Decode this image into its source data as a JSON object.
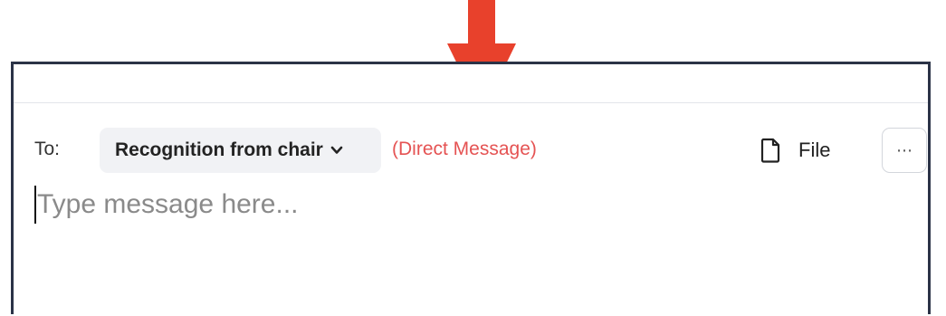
{
  "composer": {
    "to_label": "To:",
    "recipient": "Recognition from chair",
    "message_type": "(Direct Message)",
    "file_label": "File",
    "more_label": "⋯",
    "message_value": "",
    "message_placeholder": "Type message here..."
  },
  "icons": {
    "recipient_dropdown": "chevron-down-icon",
    "file": "file-icon",
    "more": "more-options-icon",
    "annotation": "arrow-down-icon"
  },
  "colors": {
    "arrow": "#e8412c",
    "direct_message": "#e55353",
    "panel_border": "#2b3347",
    "recipient_bg": "#f1f2f5"
  }
}
